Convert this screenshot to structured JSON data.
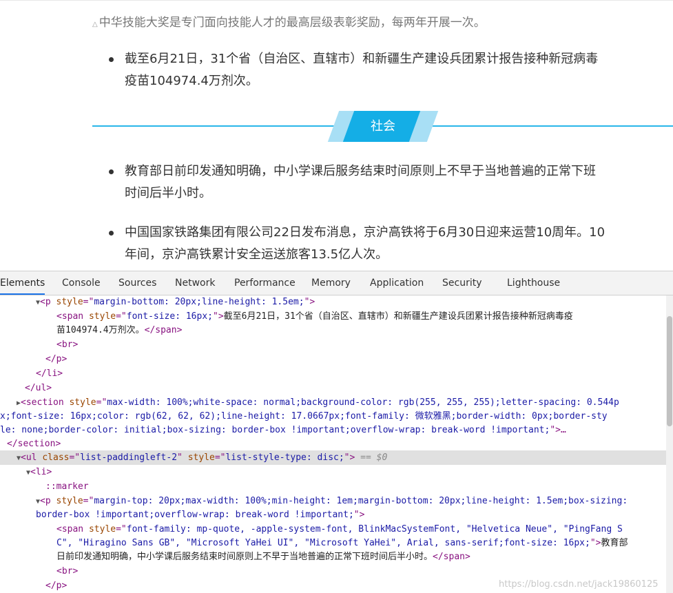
{
  "article": {
    "note": "中华技能大奖是专门面向技能人才的最高层级表彰奖励，每两年开展一次。",
    "bullets_top": [
      "截至6月21日，31个省（自治区、直辖市）和新疆生产建设兵团累计报告接种新冠病毒\n疫苗104974.4万剂次。"
    ],
    "section_title": "社会",
    "bullets_bottom": [
      "教育部日前印发通知明确，中小学课后服务结束时间原则上不早于当地普遍的正常下班\n时间后半小时。",
      "中国国家铁路集团有限公司22日发布消息，京沪高铁将于6月30日迎来运营10周年。10\n年间，京沪高铁累计安全运送旅客13.5亿人次。"
    ]
  },
  "devtools": {
    "tabs": [
      "Elements",
      "Console",
      "Sources",
      "Network",
      "Performance",
      "Memory",
      "Application",
      "Security",
      "Lighthouse"
    ],
    "active_tab": "Elements",
    "code": {
      "l1_tag": "p",
      "l1_attr": "style",
      "l1_val": "margin-bottom: 20px;line-height: 1.5em;",
      "l2_tag": "span",
      "l2_attr": "style",
      "l2_val": "font-size: 16px;",
      "l2_text": "截至6月21日，31个省（自治区、直辖市）和新疆生产建设兵团累计报告接种新冠病毒疫",
      "l3_text": "苗104974.4万剂次。",
      "l3_close": "</span>",
      "l4": "<br>",
      "l5": "</p>",
      "l6": "</li>",
      "l7": "</ul>",
      "l8_tag": "section",
      "l8_attr": "style",
      "l8_val": "max-width: 100%;white-space: normal;background-color: rgb(255, 255, 255);letter-spacing: 0.544p",
      "l9_val": "x;font-size: 16px;color: rgb(62, 62, 62);line-height: 17.0667px;font-family: 微软雅黑;border-width: 0px;border-sty",
      "l10_val": "le: none;border-color: initial;box-sizing: border-box !important;overflow-wrap: break-word !important;",
      "l10_end": "\">…",
      "l11": "</section>",
      "l12_tag": "ul",
      "l12_attr1": "class",
      "l12_val1": "list-paddingleft-2",
      "l12_attr2": "style",
      "l12_val2": "list-style-type: disc;",
      "l12_eq": "== $0",
      "l13": "<li>",
      "l14": "::marker",
      "l15_tag": "p",
      "l15_attr": "style",
      "l15_val": "margin-top: 20px;max-width: 100%;min-height: 1em;margin-bottom: 20px;line-height: 1.5em;box-sizing:",
      "l16_val": "border-box !important;overflow-wrap: break-word !important;",
      "l17_tag": "span",
      "l17_attr": "style",
      "l17_val": "font-family: mp-quote, -apple-system-font, BlinkMacSystemFont, \"Helvetica Neue\", \"PingFang S",
      "l18_val": "C\", \"Hiragino Sans GB\", \"Microsoft YaHei UI\", \"Microsoft YaHei\", Arial, sans-serif;font-size: 16px;",
      "l18_text": "教育部",
      "l19_text": "日前印发通知明确，中小学课后服务结束时间原则上不早于当地普遍的正常下班时间后半小时。",
      "l19_close": "</span>",
      "l20": "<br>",
      "l21": "</p>"
    },
    "watermark": "https://blog.csdn.net/jack19860125"
  }
}
